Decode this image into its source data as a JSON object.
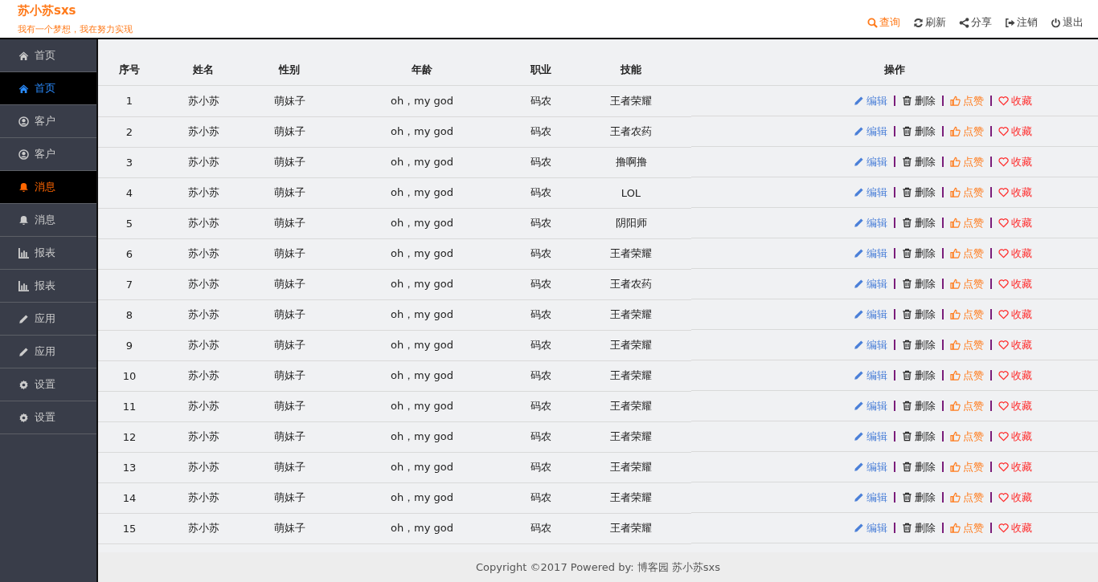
{
  "brand": {
    "title": "苏小苏sxs",
    "slogan": "我有一个梦想，我在努力实现"
  },
  "header_actions": [
    {
      "kind": "search",
      "label": "查询",
      "selected": true
    },
    {
      "kind": "refresh",
      "label": "刷新",
      "selected": false
    },
    {
      "kind": "share",
      "label": "分享",
      "selected": false
    },
    {
      "kind": "logout",
      "label": "注销",
      "selected": false
    },
    {
      "kind": "power",
      "label": "退出",
      "selected": false
    }
  ],
  "sidebar": {
    "items": [
      {
        "kind": "home",
        "label": "首页",
        "selected": false,
        "color": "#cccccc"
      },
      {
        "kind": "home",
        "label": "首页",
        "selected": true,
        "color": "#2a8cff"
      },
      {
        "kind": "user",
        "label": "客户",
        "selected": false,
        "color": "#cccccc"
      },
      {
        "kind": "user",
        "label": "客户",
        "selected": false,
        "color": "#cccccc"
      },
      {
        "kind": "bell",
        "label": "消息",
        "selected": true,
        "color": "#ff6600"
      },
      {
        "kind": "bell",
        "label": "消息",
        "selected": false,
        "color": "#cccccc"
      },
      {
        "kind": "chart",
        "label": "报表",
        "selected": false,
        "color": "#cccccc"
      },
      {
        "kind": "chart",
        "label": "报表",
        "selected": false,
        "color": "#cccccc"
      },
      {
        "kind": "pencil",
        "label": "应用",
        "selected": false,
        "color": "#cccccc"
      },
      {
        "kind": "pencil",
        "label": "应用",
        "selected": false,
        "color": "#cccccc"
      },
      {
        "kind": "gear",
        "label": "设置",
        "selected": false,
        "color": "#cccccc"
      },
      {
        "kind": "gear",
        "label": "设置",
        "selected": false,
        "color": "#cccccc"
      }
    ]
  },
  "table": {
    "columns": [
      "序号",
      "姓名",
      "性别",
      "年龄",
      "职业",
      "技能",
      "操作"
    ],
    "rows": [
      {
        "cells": [
          "1",
          "苏小苏",
          "萌妹子",
          "oh，my god",
          "码农",
          "王者荣耀"
        ],
        "actions": [
          "编辑",
          "删除",
          "点赞",
          "收藏"
        ]
      },
      {
        "cells": [
          "2",
          "苏小苏",
          "萌妹子",
          "oh，my god",
          "码农",
          "王者农药"
        ],
        "actions": [
          "编辑",
          "删除",
          "点赞",
          "收藏"
        ]
      },
      {
        "cells": [
          "3",
          "苏小苏",
          "萌妹子",
          "oh，my god",
          "码农",
          "撸啊撸"
        ],
        "actions": [
          "编辑",
          "删除",
          "点赞",
          "收藏"
        ]
      },
      {
        "cells": [
          "4",
          "苏小苏",
          "萌妹子",
          "oh，my god",
          "码农",
          "LOL"
        ],
        "actions": [
          "编辑",
          "删除",
          "点赞",
          "收藏"
        ]
      },
      {
        "cells": [
          "5",
          "苏小苏",
          "萌妹子",
          "oh，my god",
          "码农",
          "阴阳师"
        ],
        "actions": [
          "编辑",
          "删除",
          "点赞",
          "收藏"
        ]
      },
      {
        "cells": [
          "6",
          "苏小苏",
          "萌妹子",
          "oh，my god",
          "码农",
          "王者荣耀"
        ],
        "actions": [
          "编辑",
          "删除",
          "点赞",
          "收藏"
        ]
      },
      {
        "cells": [
          "7",
          "苏小苏",
          "萌妹子",
          "oh，my god",
          "码农",
          "王者农药"
        ],
        "actions": [
          "编辑",
          "删除",
          "点赞",
          "收藏"
        ]
      },
      {
        "cells": [
          "8",
          "苏小苏",
          "萌妹子",
          "oh，my god",
          "码农",
          "王者荣耀"
        ],
        "actions": [
          "编辑",
          "删除",
          "点赞",
          "收藏"
        ]
      },
      {
        "cells": [
          "9",
          "苏小苏",
          "萌妹子",
          "oh，my god",
          "码农",
          "王者荣耀"
        ],
        "actions": [
          "编辑",
          "删除",
          "点赞",
          "收藏"
        ]
      },
      {
        "cells": [
          "10",
          "苏小苏",
          "萌妹子",
          "oh，my god",
          "码农",
          "王者荣耀"
        ],
        "actions": [
          "编辑",
          "删除",
          "点赞",
          "收藏"
        ]
      },
      {
        "cells": [
          "11",
          "苏小苏",
          "萌妹子",
          "oh，my god",
          "码农",
          "王者荣耀"
        ],
        "actions": [
          "编辑",
          "删除",
          "点赞",
          "收藏"
        ]
      },
      {
        "cells": [
          "12",
          "苏小苏",
          "萌妹子",
          "oh，my god",
          "码农",
          "王者荣耀"
        ],
        "actions": [
          "编辑",
          "删除",
          "点赞",
          "收藏"
        ]
      },
      {
        "cells": [
          "13",
          "苏小苏",
          "萌妹子",
          "oh，my god",
          "码农",
          "王者荣耀"
        ],
        "actions": [
          "编辑",
          "删除",
          "点赞",
          "收藏"
        ]
      },
      {
        "cells": [
          "14",
          "苏小苏",
          "萌妹子",
          "oh，my god",
          "码农",
          "王者荣耀"
        ],
        "actions": [
          "编辑",
          "删除",
          "点赞",
          "收藏"
        ]
      },
      {
        "cells": [
          "15",
          "苏小苏",
          "萌妹子",
          "oh，my god",
          "码农",
          "王者荣耀"
        ],
        "actions": [
          "编辑",
          "删除",
          "点赞",
          "收藏"
        ]
      }
    ]
  },
  "footer": "Copyright ©2017 Powered by: 博客园 苏小苏sxs"
}
